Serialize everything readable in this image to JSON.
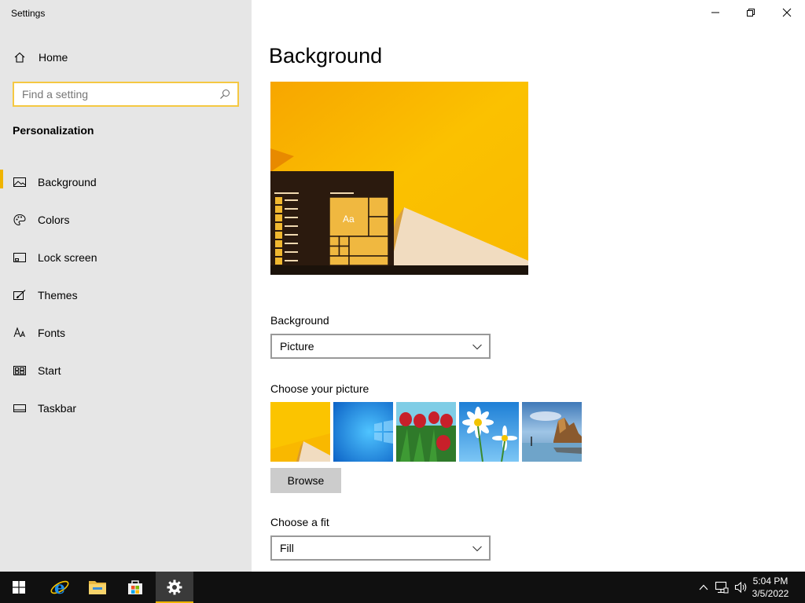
{
  "app": {
    "title": "Settings"
  },
  "sidebar": {
    "home_label": "Home",
    "search_placeholder": "Find a setting",
    "section_title": "Personalization",
    "items": [
      {
        "label": "Background",
        "icon": "picture-icon",
        "active": true
      },
      {
        "label": "Colors",
        "icon": "palette-icon"
      },
      {
        "label": "Lock screen",
        "icon": "lock-screen-icon"
      },
      {
        "label": "Themes",
        "icon": "themes-icon"
      },
      {
        "label": "Fonts",
        "icon": "fonts-icon"
      },
      {
        "label": "Start",
        "icon": "start-icon"
      },
      {
        "label": "Taskbar",
        "icon": "taskbar-icon"
      }
    ]
  },
  "main": {
    "title": "Background",
    "preview_tile_text": "Aa",
    "background_label": "Background",
    "background_value": "Picture",
    "choose_picture_label": "Choose your picture",
    "pictures": [
      "yellow-abstract",
      "windows-blue",
      "red-tulips",
      "white-daisies",
      "coastal-rocks"
    ],
    "browse_label": "Browse",
    "fit_label": "Choose a fit",
    "fit_value": "Fill"
  },
  "taskbar": {
    "apps": [
      "start-button",
      "internet-explorer",
      "file-explorer",
      "store",
      "settings"
    ],
    "active_app": "settings",
    "time": "5:04 PM",
    "date": "3/5/2022"
  },
  "colors": {
    "accent": "#f0b400",
    "sidebar_bg": "#e6e6e6",
    "taskbar_bg": "#101010"
  }
}
